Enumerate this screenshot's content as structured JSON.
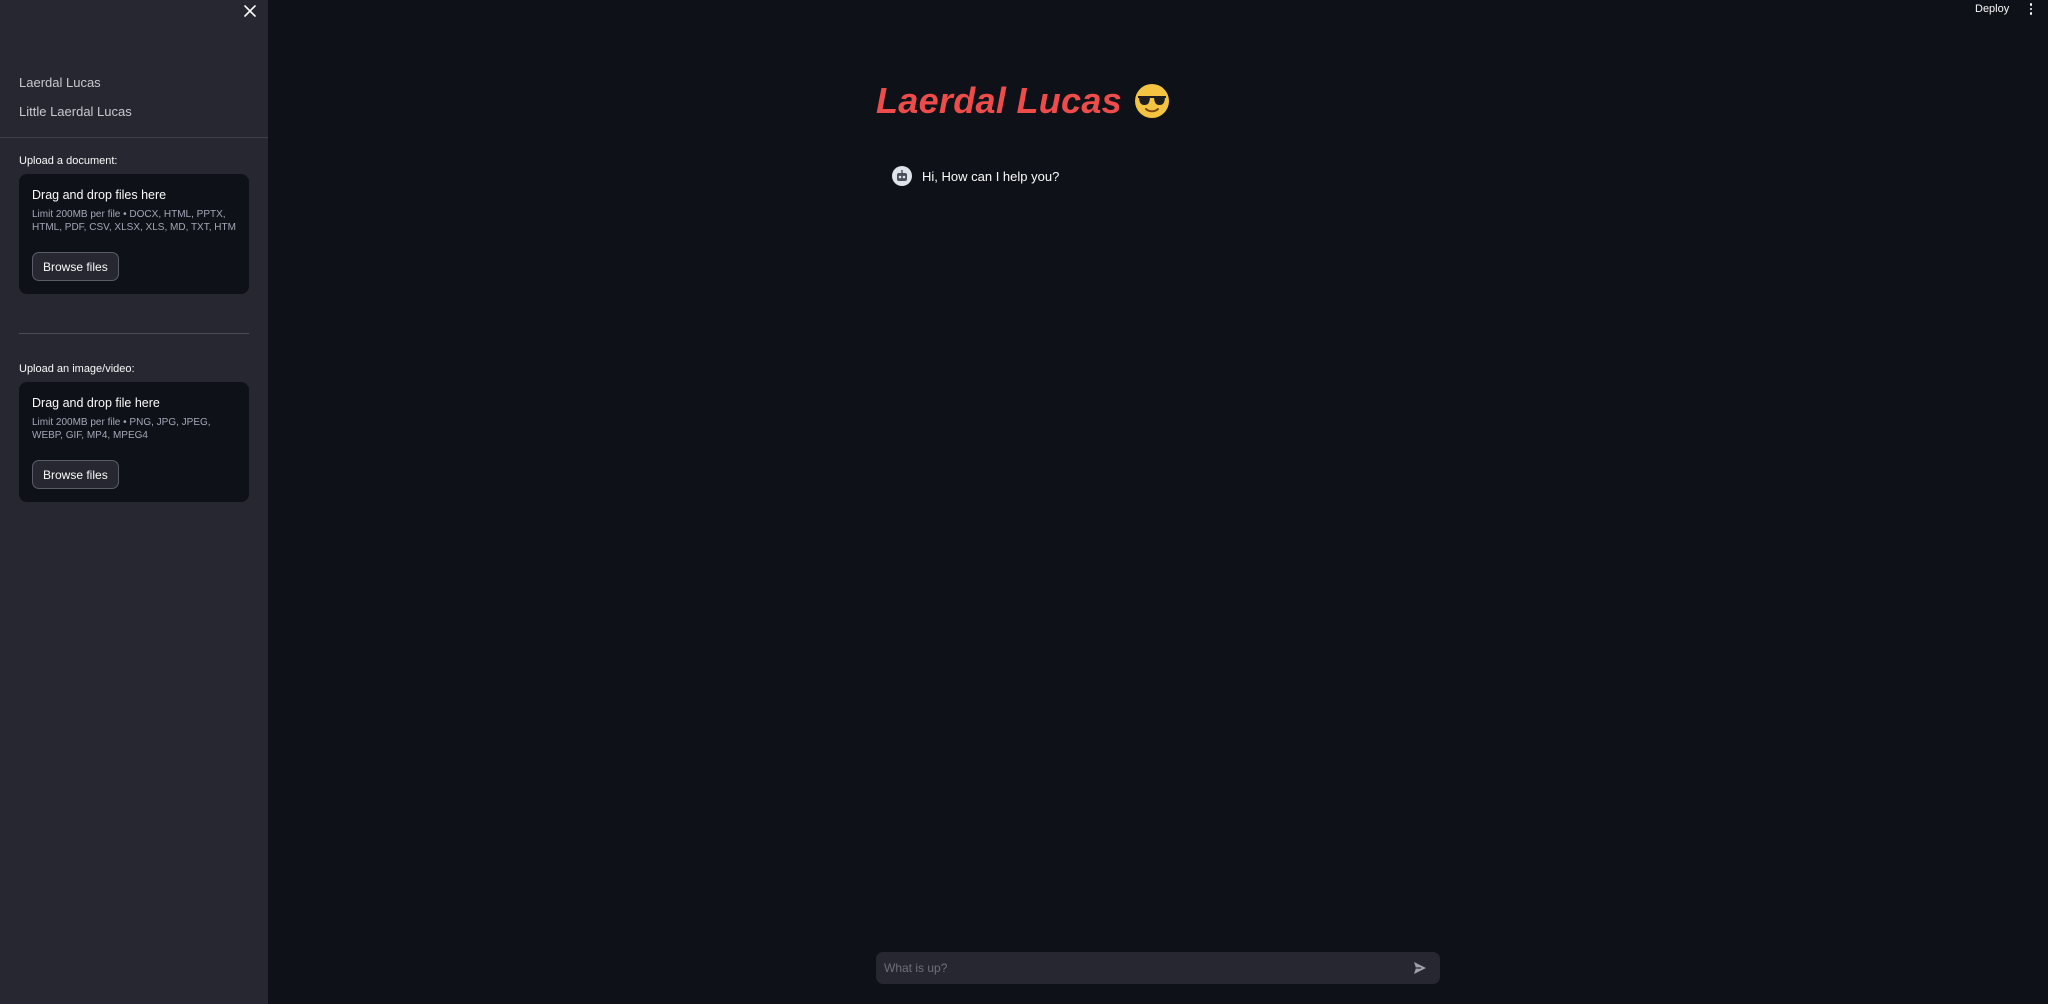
{
  "sidebar": {
    "nav_items": [
      {
        "label": "Laerdal Lucas"
      },
      {
        "label": "Little Laerdal Lucas"
      }
    ],
    "document_upload": {
      "label": "Upload a document:",
      "title": "Drag and drop files here",
      "limit_text": "Limit 200MB per file • DOCX, HTML, PPTX, HTML, PDF, CSV, XLSX, XLS, MD, TXT, HTM",
      "button_label": "Browse files"
    },
    "media_upload": {
      "label": "Upload an image/video:",
      "title": "Drag and drop file here",
      "limit_text": "Limit 200MB per file • PNG, JPG, JPEG, WEBP, GIF, MP4, MPEG4",
      "button_label": "Browse files"
    }
  },
  "header": {
    "deploy_label": "Deploy"
  },
  "main": {
    "title": "Laerdal Lucas",
    "title_icon": "sunglasses-emoji-icon",
    "messages": [
      {
        "text": "Hi, How can I help you?",
        "avatar": "robot-avatar-icon"
      }
    ],
    "chat_input": {
      "placeholder": "What is up?"
    }
  },
  "colors": {
    "background": "#0e1117",
    "sidebar": "#262730",
    "title": "#ee4b4b"
  }
}
